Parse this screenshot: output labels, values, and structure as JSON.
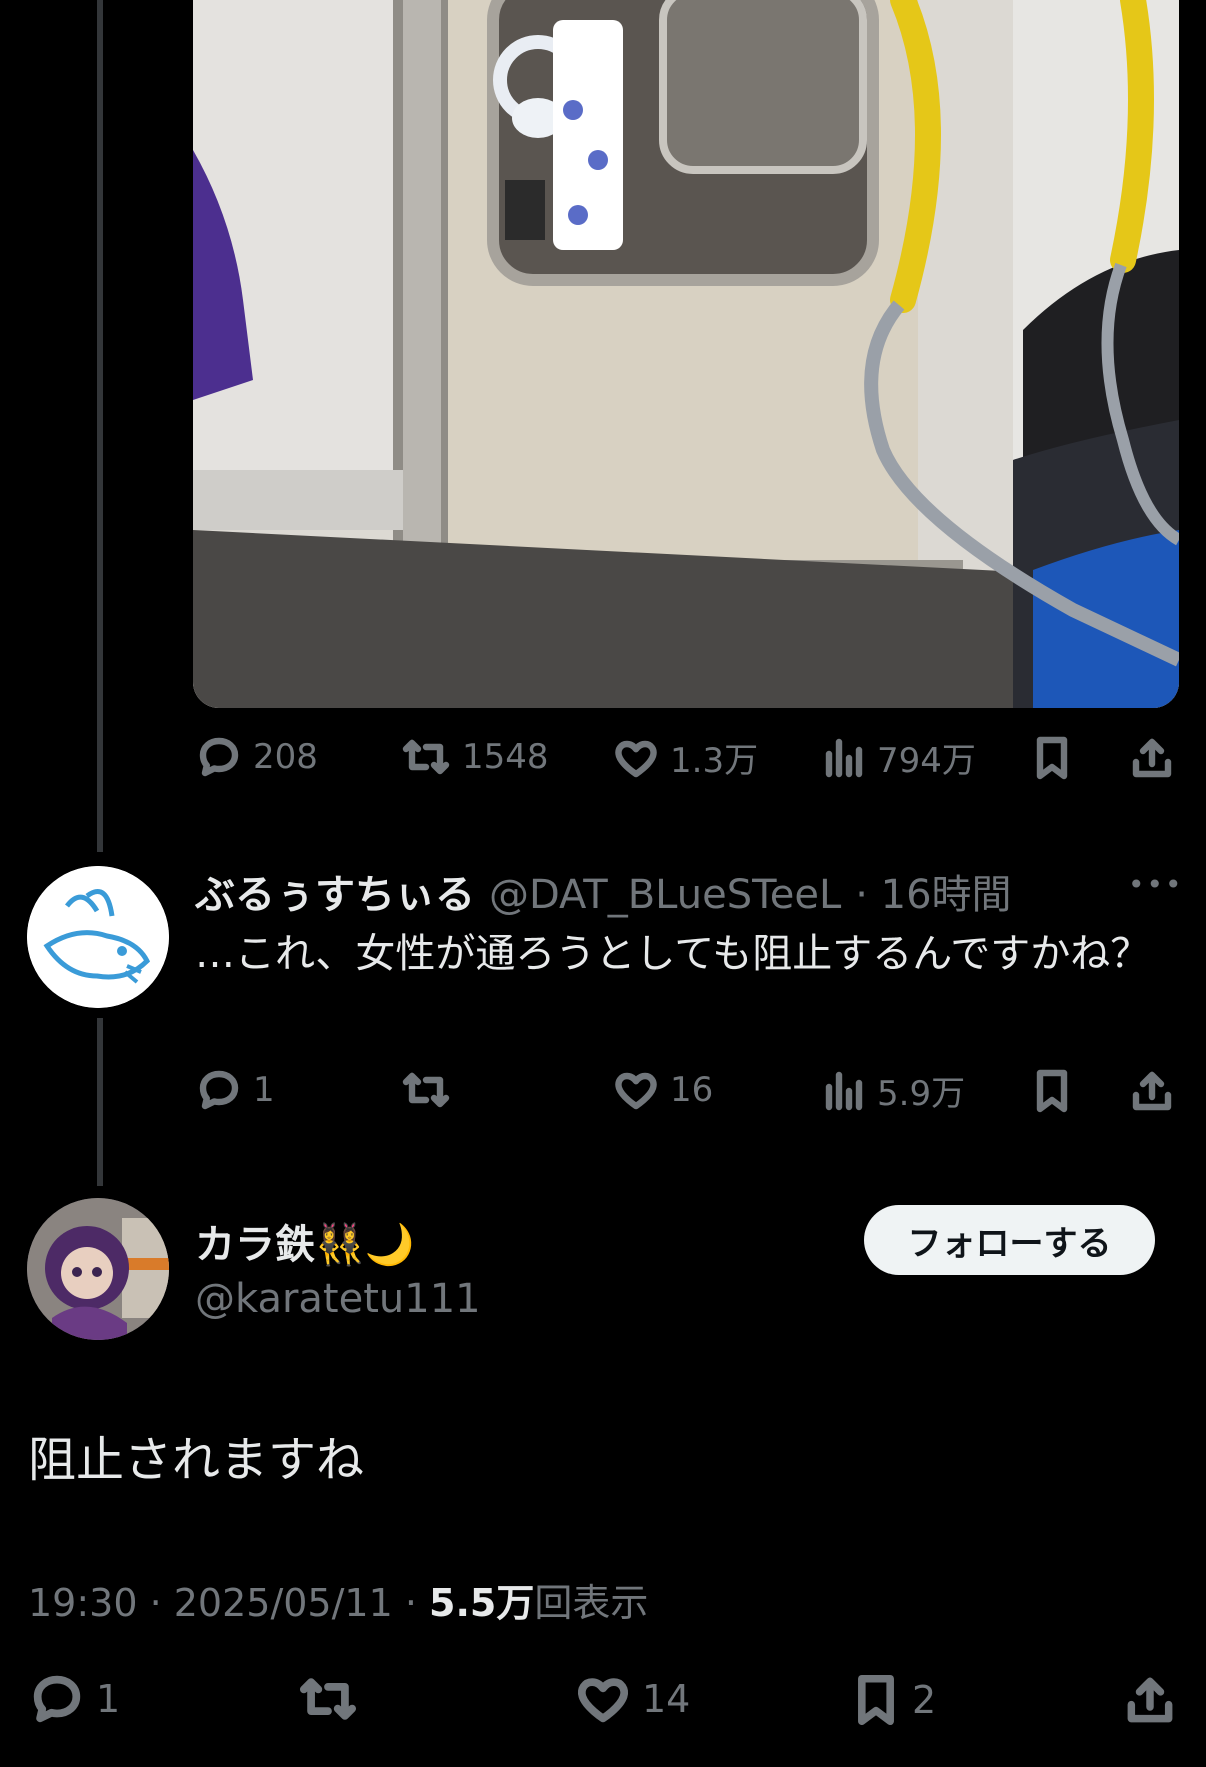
{
  "media": {
    "description_icon": "photo-icon"
  },
  "original_tweet": {
    "actions": {
      "replies": "208",
      "retweets": "1548",
      "likes": "1.3万",
      "views": "794万"
    }
  },
  "reply": {
    "display_name": "ぶるぅすちぃる",
    "handle": "@DAT_BLueSTeeL",
    "time": "· 16時間",
    "more": "•••",
    "text": "…これ、女性が通ろうとしても阻止するんですかね？",
    "actions": {
      "replies": "1",
      "retweets": "",
      "likes": "16",
      "views": "5.9万"
    }
  },
  "main_tweet": {
    "display_name": "カラ鉄👯‍♀️🌙",
    "handle": "@karatetu111",
    "follow_label": "フォローする",
    "text": "阻止されますね",
    "time_date": "19:30 · 2025/05/11 · ",
    "view_count": "5.5万",
    "view_label": "回表示",
    "actions": {
      "replies": "1",
      "retweets": "",
      "likes": "14",
      "bookmarks": "2"
    }
  },
  "colors": {
    "background": "#000000",
    "muted": "#71767b",
    "text": "#e7e9ea",
    "button": "#eff3f4"
  }
}
